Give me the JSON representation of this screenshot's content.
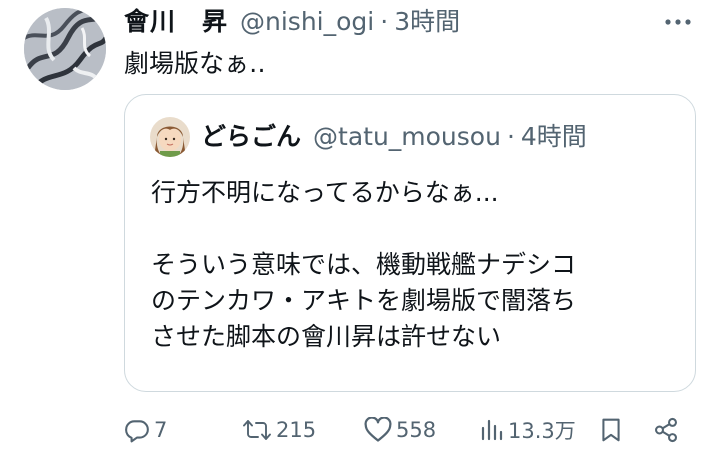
{
  "tweet": {
    "author": {
      "display_name": "會川　昇",
      "handle": "@nishi_ogi",
      "time": "3時間",
      "separator": "·"
    },
    "text": "劇場版なぁ‥"
  },
  "quoted_tweet": {
    "author": {
      "display_name": "どらごん",
      "handle": "@tatu_mousou",
      "time": "4時間",
      "separator": "·"
    },
    "lines": [
      "行方不明になってるからなぁ...",
      "",
      "そういう意味では、機動戦艦ナデシコ",
      "のテンカワ・アキトを劇場版で闇落ち",
      "させた脚本の會川昇は許せない"
    ]
  },
  "actions": {
    "reply_count": "7",
    "retweet_count": "215",
    "like_count": "558",
    "view_count": "13.3万"
  },
  "icons": {
    "more": "more-dots-icon",
    "reply": "reply-icon",
    "retweet": "retweet-icon",
    "like": "heart-icon",
    "views": "views-chart-icon",
    "bookmark": "bookmark-icon",
    "share": "share-icon"
  },
  "colors": {
    "text": "#0f1419",
    "secondary": "#536471",
    "border": "#cfd9de"
  }
}
